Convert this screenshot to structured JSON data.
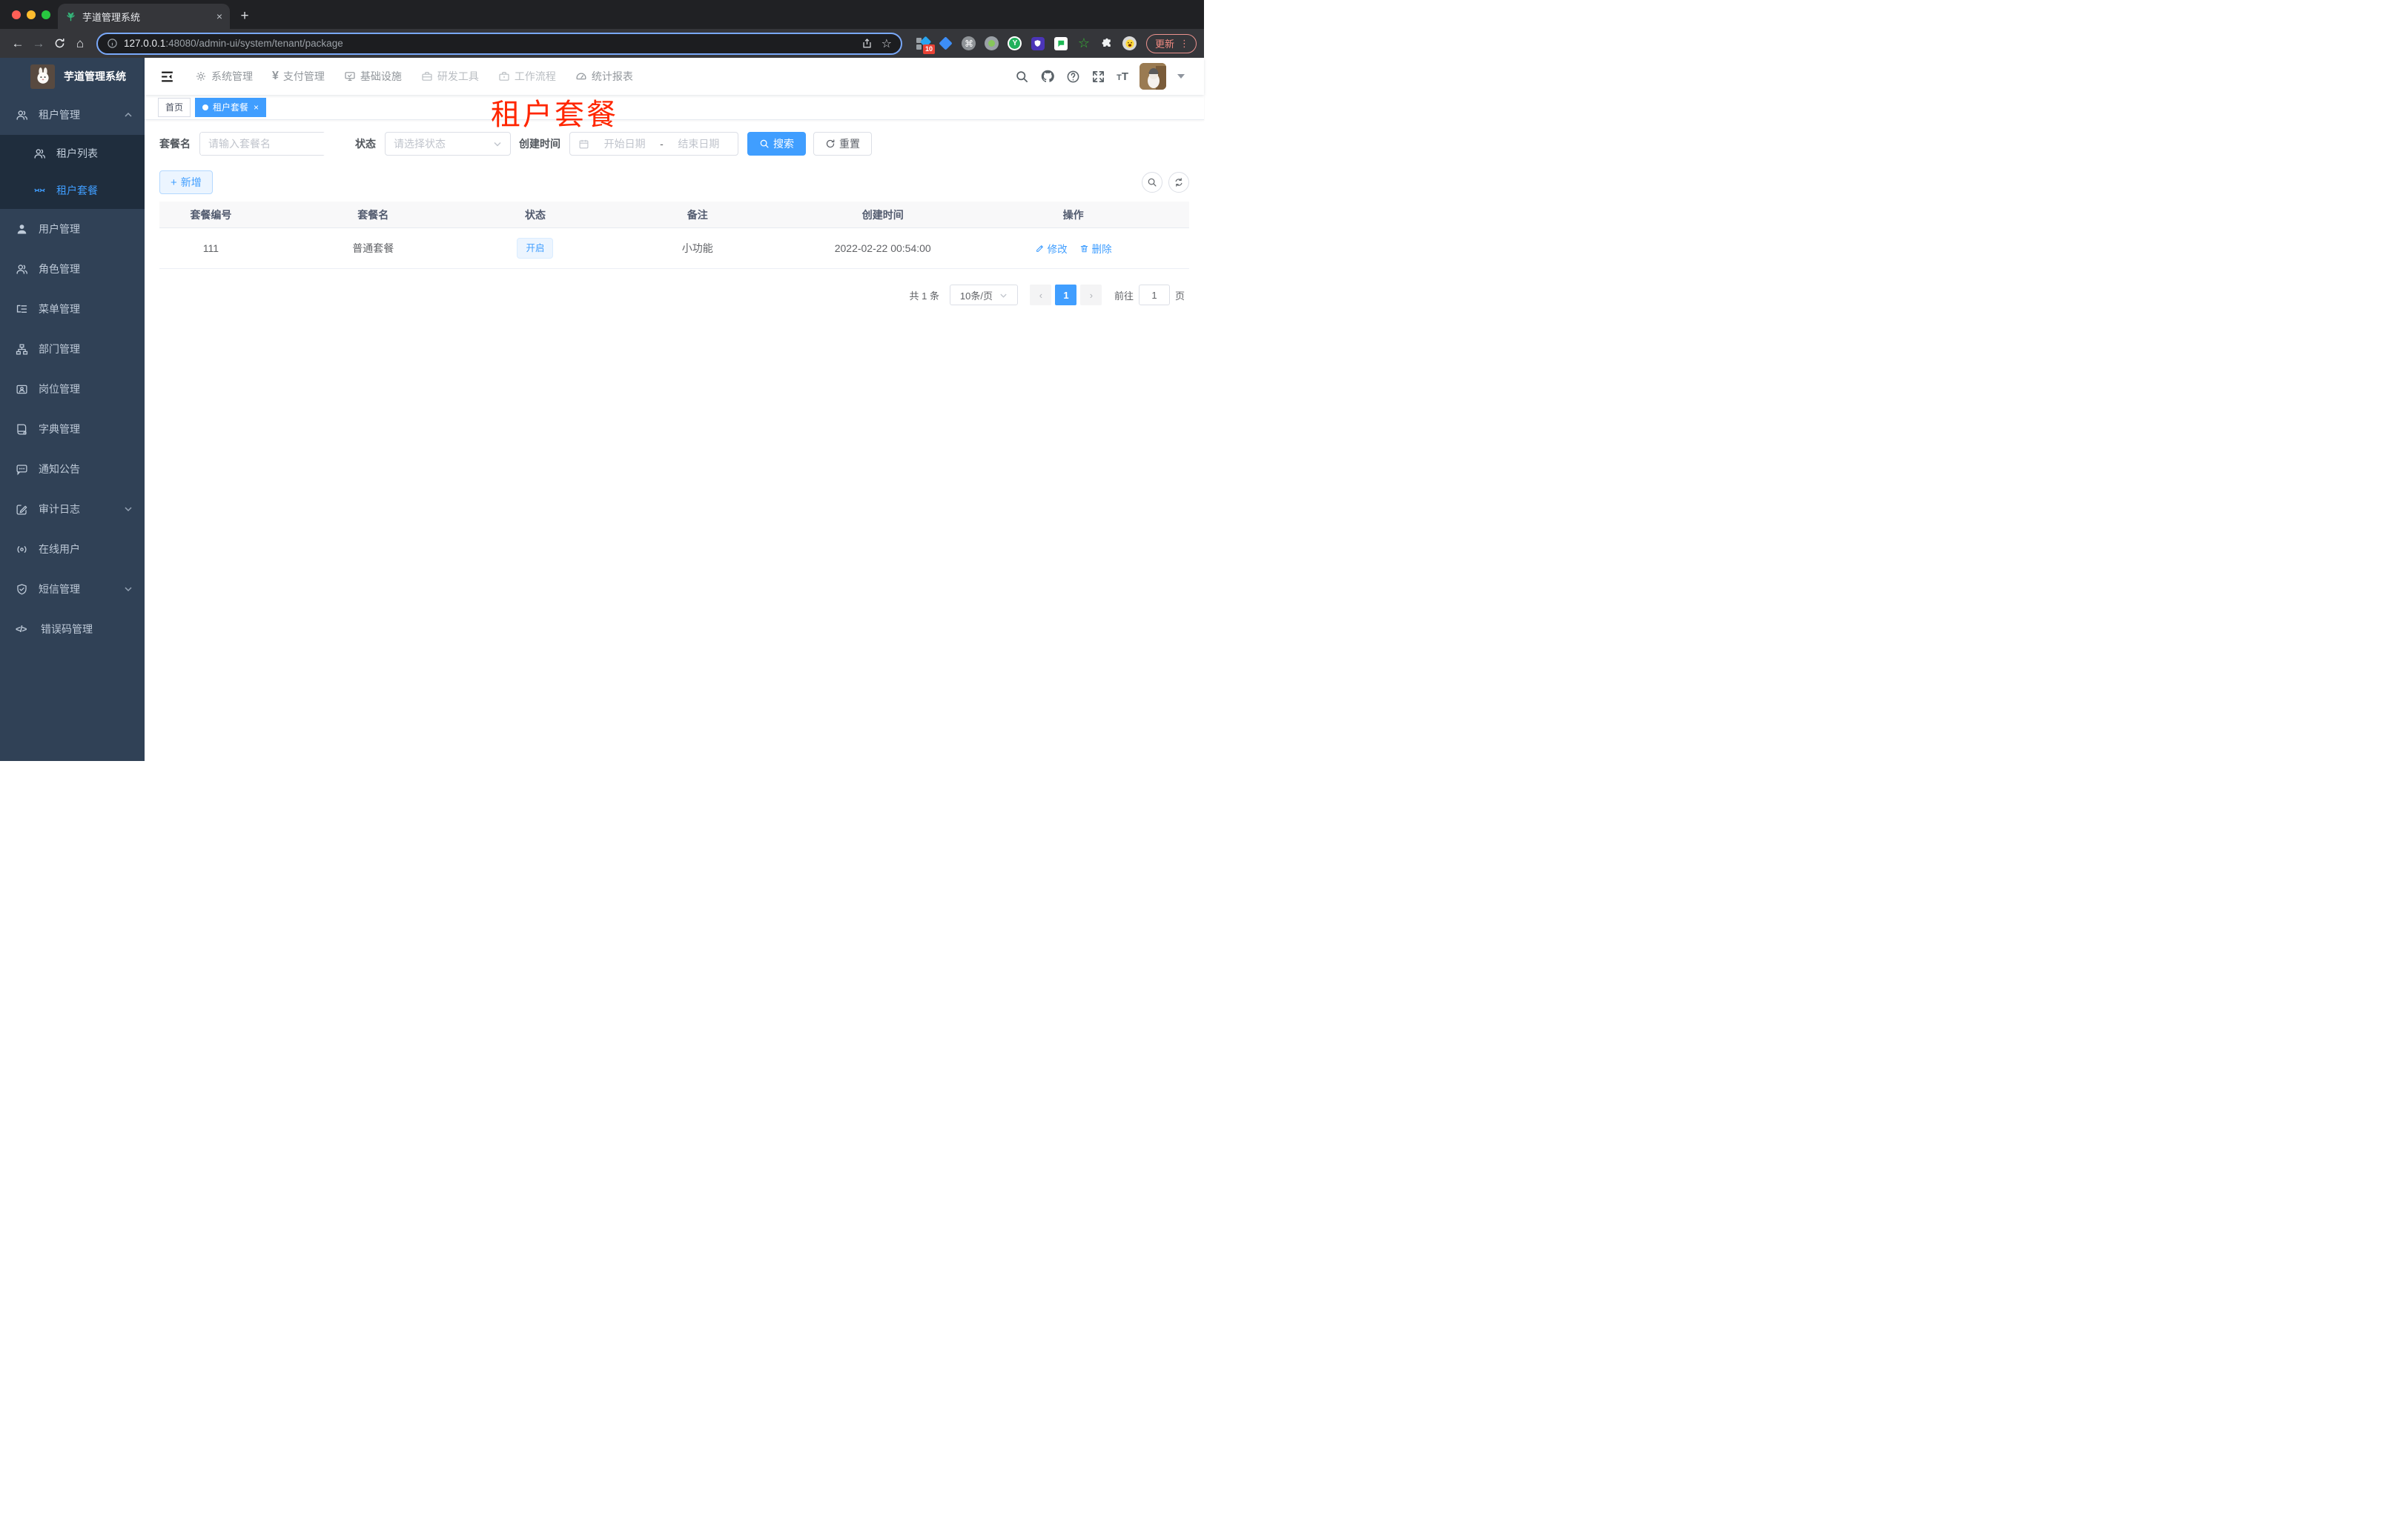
{
  "browser": {
    "tab_title": "芋道管理系统",
    "tab_close": "×",
    "new_tab": "+",
    "url_host": "127.0.0.1",
    "url_rest": ":48080/admin-ui/system/tenant/package",
    "extension_badge": "10",
    "update_label": "更新",
    "menu_dots": "⋮",
    "back": "←",
    "forward": "→",
    "home": "⌂",
    "star": "☆",
    "cmd": "⌘",
    "ext_y": "Y",
    "ext_star": "☆"
  },
  "sidebar": {
    "title": "芋道管理系统",
    "items": [
      {
        "label": "租户管理",
        "icon": "people-icon",
        "state": "expanded"
      },
      {
        "label": "租户列表",
        "icon": "people-icon"
      },
      {
        "label": "租户套餐",
        "icon": "package-icon",
        "state": "active"
      },
      {
        "label": "用户管理",
        "icon": "user-icon"
      },
      {
        "label": "角色管理",
        "icon": "people-icon"
      },
      {
        "label": "菜单管理",
        "icon": "tree-icon"
      },
      {
        "label": "部门管理",
        "icon": "org-icon"
      },
      {
        "label": "岗位管理",
        "icon": "badge-icon"
      },
      {
        "label": "字典管理",
        "icon": "book-icon"
      },
      {
        "label": "通知公告",
        "icon": "message-icon"
      },
      {
        "label": "审计日志",
        "icon": "edit-log-icon",
        "state": "collapsed"
      },
      {
        "label": "在线用户",
        "icon": "online-icon"
      },
      {
        "label": "短信管理",
        "icon": "shield-icon",
        "state": "collapsed"
      },
      {
        "label": "错误码管理",
        "icon": "code-icon",
        "code_glyph": "</>"
      }
    ]
  },
  "topnav": {
    "menus": [
      {
        "label": "系统管理",
        "icon": "gear-icon"
      },
      {
        "label": "支付管理",
        "icon": "yen-icon",
        "glyph": "¥"
      },
      {
        "label": "基础设施",
        "icon": "monitor-icon"
      },
      {
        "label": "研发工具",
        "icon": "toolbox-icon"
      },
      {
        "label": "工作流程",
        "icon": "briefcase-icon"
      },
      {
        "label": "统计报表",
        "icon": "gauge-icon"
      }
    ],
    "right_icons": [
      "search-icon",
      "github-icon",
      "help-icon",
      "fullscreen-icon",
      "font-size-icon",
      "avatar",
      "caret-down-icon"
    ],
    "font_size_big": "T",
    "font_size_small": "T"
  },
  "tags": {
    "home": "首页",
    "active_label": "租户套餐",
    "close": "×"
  },
  "annotation": {
    "text": "租户套餐",
    "color": "#ff2600"
  },
  "filters": {
    "name_label": "套餐名",
    "name_placeholder": "请输入套餐名",
    "status_label": "状态",
    "status_placeholder": "请选择状态",
    "time_label": "创建时间",
    "start_placeholder": "开始日期",
    "separator": "-",
    "end_placeholder": "结束日期",
    "search_label": "搜索",
    "reset_label": "重置"
  },
  "toolbar": {
    "add_label": "新增",
    "plus": "+"
  },
  "table": {
    "columns": [
      "套餐编号",
      "套餐名",
      "状态",
      "备注",
      "创建时间",
      "操作"
    ],
    "rows": [
      {
        "id": "111",
        "name": "普通套餐",
        "status": "开启",
        "remark": "小功能",
        "create_time": "2022-02-22 00:54:00",
        "action_edit": "修改",
        "action_delete": "删除"
      }
    ]
  },
  "pagination": {
    "total_text": "共 1 条",
    "page_size": "10条/页",
    "prev": "‹",
    "current_page": "1",
    "next": "›",
    "goto_label": "前往",
    "goto_value": "1",
    "goto_unit": "页"
  },
  "colors": {
    "accent": "#409eff",
    "sidebar_bg": "#304156",
    "submenu_bg": "#1f2d3d",
    "annotation_red": "#ff2600",
    "tag_bg": "#ecf5ff"
  }
}
